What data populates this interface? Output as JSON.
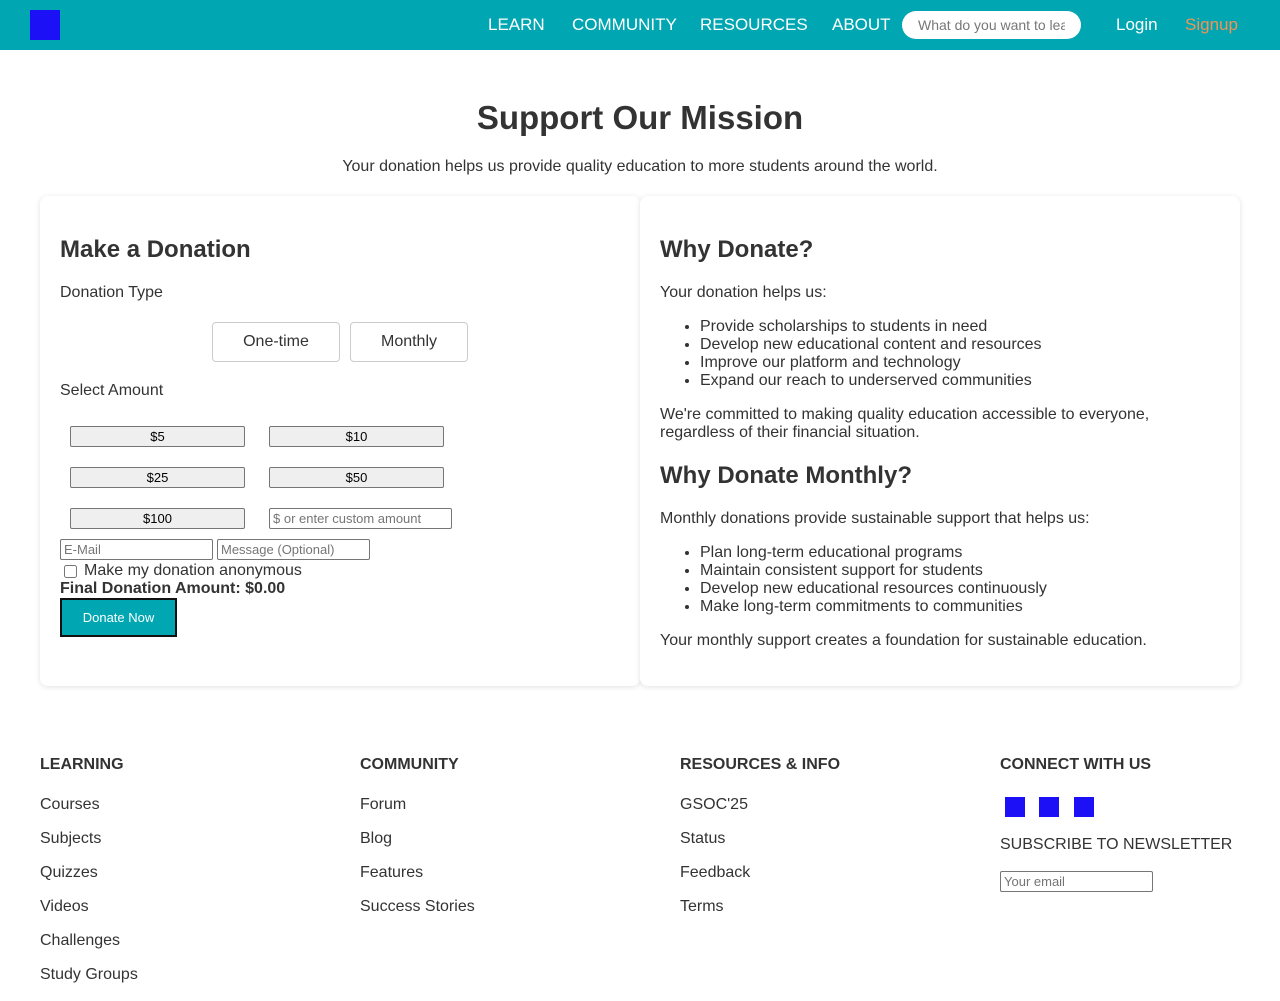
{
  "nav": {
    "logo_icon": "logo-square",
    "links": [
      "LEARN",
      "COMMUNITY",
      "RESOURCES",
      "ABOUT"
    ],
    "search_placeholder": "What do you want to learn?",
    "login": "Login",
    "signup": "Signup"
  },
  "hero": {
    "title": "Support Our Mission",
    "subtitle": "Your donation helps us provide quality education to more students around the world."
  },
  "donation": {
    "title": "Make a Donation",
    "type_label": "Donation Type",
    "type_options": [
      "One-time",
      "Monthly"
    ],
    "amount_label": "Select Amount",
    "amounts": [
      "$5",
      "$10",
      "$25",
      "$50",
      "$100"
    ],
    "custom_placeholder": "$ or enter custom amount",
    "email_placeholder": "E-Mail",
    "message_placeholder": "Message (Optional)",
    "anonymous_label": "Make my donation anonymous",
    "final_amount": "Final Donation Amount: $0.00",
    "donate_button": "Donate Now"
  },
  "why": {
    "title": "Why Donate?",
    "intro": "Your donation helps us:",
    "items": [
      "Provide scholarships to students in need",
      "Develop new educational content and resources",
      "Improve our platform and technology",
      "Expand our reach to underserved communities"
    ],
    "closing": "We're committed to making quality education accessible to everyone, regardless of their financial situation."
  },
  "why_monthly": {
    "title": "Why Donate Monthly?",
    "intro": "Monthly donations provide sustainable support that helps us:",
    "items": [
      "Plan long-term educational programs",
      "Maintain consistent support for students",
      "Develop new educational resources continuously",
      "Make long-term commitments to communities"
    ],
    "closing": "Your monthly support creates a foundation for sustainable education."
  },
  "footer": {
    "learning": {
      "heading": "LEARNING",
      "links": [
        "Courses",
        "Subjects",
        "Quizzes",
        "Videos",
        "Challenges",
        "Study Groups"
      ]
    },
    "community": {
      "heading": "COMMUNITY",
      "links": [
        "Forum",
        "Blog",
        "Features",
        "Success Stories"
      ]
    },
    "resources": {
      "heading": "RESOURCES & INFO",
      "links": [
        "GSOC'25",
        "Status",
        "Feedback",
        "Terms"
      ]
    },
    "connect": {
      "heading": "CONNECT WITH US",
      "social_icons": [
        "social-icon",
        "social-icon",
        "social-icon"
      ],
      "newsletter_label": "SUBSCRIBE TO NEWSLETTER",
      "email_placeholder": "Your email"
    }
  },
  "colors": {
    "primary": "#00a6b1",
    "signup": "#f19457",
    "icon_placeholder": "#1c10f7",
    "text": "#333333"
  }
}
